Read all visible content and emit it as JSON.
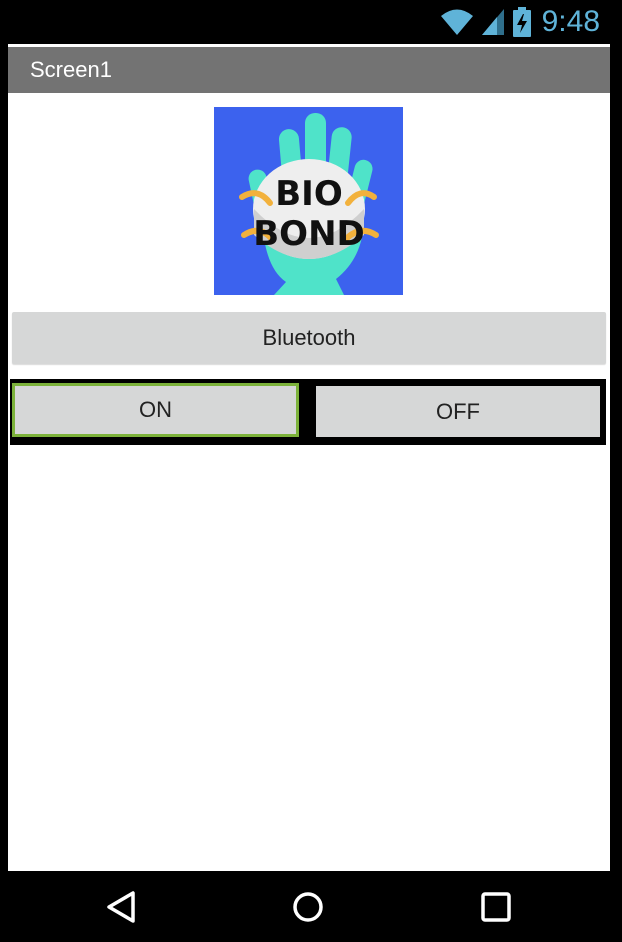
{
  "status_bar": {
    "time": "9:48"
  },
  "app": {
    "screen_title": "Screen1",
    "logo": {
      "line1": "BIO",
      "line2": "BOND",
      "background_color": "#3c62ee",
      "hand_color": "#4fe3c9"
    },
    "bluetooth_button": "Bluetooth",
    "on_button": "ON",
    "off_button": "OFF",
    "selected_toggle": "ON",
    "accent_color": "#7cb23a"
  },
  "nav": {
    "back_icon": "triangle-back-icon",
    "home_icon": "circle-home-icon",
    "recents_icon": "square-recents-icon"
  }
}
